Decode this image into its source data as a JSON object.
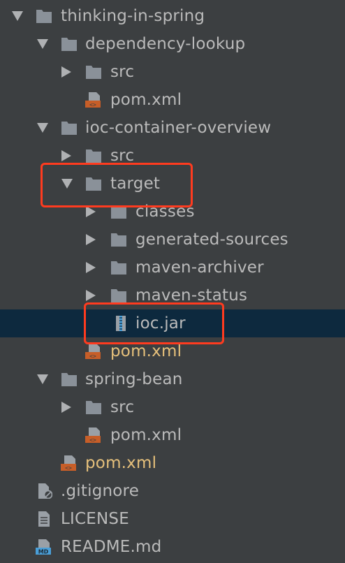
{
  "colors": {
    "background": "#3c3f41",
    "selected_row": "#0d293e",
    "text": "#bbbbbb",
    "modified_text": "#e6c07b",
    "folder_icon": "#8a9199",
    "xml_icon": "#c75e28",
    "highlight_box": "#ff3b1f"
  },
  "tree": {
    "items": [
      {
        "label": "thinking-in-spring",
        "icon": "folder-icon",
        "arrow": "expanded"
      },
      {
        "label": "dependency-lookup",
        "icon": "folder-icon",
        "arrow": "expanded"
      },
      {
        "label": "src",
        "icon": "folder-icon",
        "arrow": "collapsed"
      },
      {
        "label": "pom.xml",
        "icon": "xml-file-icon"
      },
      {
        "label": "ioc-container-overview",
        "icon": "folder-icon",
        "arrow": "expanded"
      },
      {
        "label": "src",
        "icon": "folder-icon",
        "arrow": "collapsed"
      },
      {
        "label": "target",
        "icon": "folder-icon",
        "arrow": "expanded",
        "highlighted": true
      },
      {
        "label": "classes",
        "icon": "folder-icon",
        "arrow": "collapsed"
      },
      {
        "label": "generated-sources",
        "icon": "folder-icon",
        "arrow": "collapsed"
      },
      {
        "label": "maven-archiver",
        "icon": "folder-icon",
        "arrow": "collapsed"
      },
      {
        "label": "maven-status",
        "icon": "folder-icon",
        "arrow": "collapsed"
      },
      {
        "label": "ioc.jar",
        "icon": "jar-archive-icon",
        "selected": true,
        "highlighted": true
      },
      {
        "label": "pom.xml",
        "icon": "xml-file-icon",
        "modified": true
      },
      {
        "label": "spring-bean",
        "icon": "folder-icon",
        "arrow": "expanded"
      },
      {
        "label": "src",
        "icon": "folder-icon",
        "arrow": "collapsed"
      },
      {
        "label": "pom.xml",
        "icon": "xml-file-icon"
      },
      {
        "label": "pom.xml",
        "icon": "xml-file-icon",
        "modified": true
      },
      {
        "label": ".gitignore",
        "icon": "ignored-file-icon"
      },
      {
        "label": "LICENSE",
        "icon": "text-file-icon"
      },
      {
        "label": "README.md",
        "icon": "markdown-file-icon",
        "badge": "MD"
      }
    ]
  }
}
